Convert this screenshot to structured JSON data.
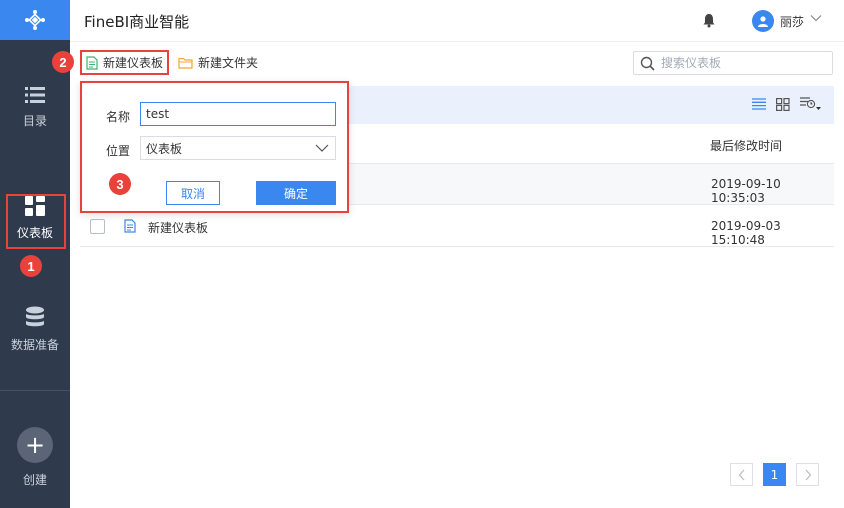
{
  "app": {
    "title": "FineBI商业智能"
  },
  "sidebar": {
    "items": [
      {
        "label": "目录",
        "icon": "list-icon"
      },
      {
        "label": "仪表板",
        "icon": "dashboard-icon"
      },
      {
        "label": "数据准备",
        "icon": "database-icon"
      }
    ],
    "create_label": "创建"
  },
  "header": {
    "user_name": "丽莎"
  },
  "toolbar": {
    "new_dashboard": "新建仪表板",
    "new_folder": "新建文件夹",
    "search_placeholder": "搜索仪表板"
  },
  "table": {
    "column_modified": "最后修改时间",
    "rows": [
      {
        "name": "",
        "modified": "2019-09-10 10:35:03"
      },
      {
        "name": "新建仪表板",
        "modified": "2019-09-03 15:10:48"
      }
    ]
  },
  "dialog": {
    "name_label": "名称",
    "name_value": "test",
    "position_label": "位置",
    "position_value": "仪表板",
    "cancel": "取消",
    "confirm": "确定"
  },
  "pagination": {
    "current": "1"
  },
  "steps": [
    "1",
    "2",
    "3"
  ],
  "colors": {
    "accent": "#3b87f0",
    "sidebar": "#2f3a4d",
    "annotation": "#e8423b"
  }
}
